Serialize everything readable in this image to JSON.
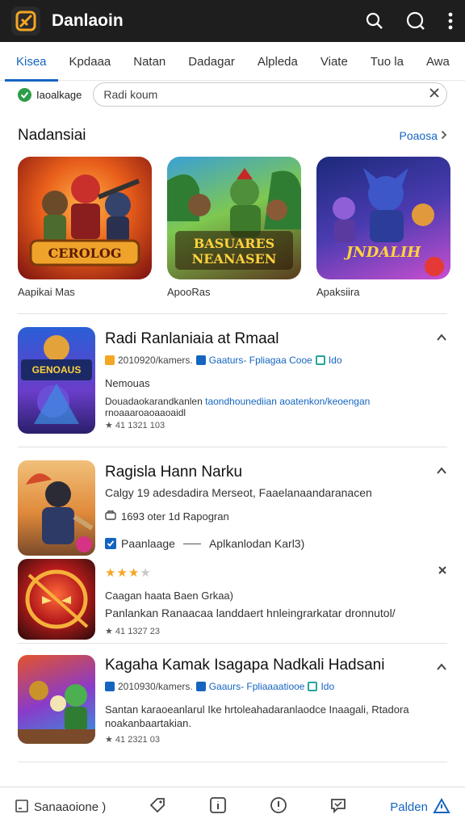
{
  "app": {
    "title": "Danlaoin"
  },
  "tabs": [
    {
      "label": "Kisea"
    },
    {
      "label": "Kpdaaa"
    },
    {
      "label": "Natan"
    },
    {
      "label": "Dadagar"
    },
    {
      "label": "Alpleda"
    },
    {
      "label": "Viate"
    },
    {
      "label": "Tuo la"
    },
    {
      "label": "Awa"
    }
  ],
  "filter": {
    "verified_label": "Iaoalkage",
    "search_value": "Radi koum"
  },
  "section": {
    "title": "Nadansiai",
    "see_more": "Poaosa"
  },
  "featured": [
    {
      "label": "Aapikai Mas",
      "art_text": "CEROLOG"
    },
    {
      "label": "ApooRas",
      "art_text": "BASUARES NEANASEN"
    },
    {
      "label": "Apaksiira",
      "art_text": "JNDALIH"
    }
  ],
  "apps": [
    {
      "title": "Radi Ranlaniaia at Rmaal",
      "meta_left": "2010920/kamers.",
      "meta_link": "Gaaturs- Fpliagaa Cooe",
      "meta_badge": "Ido",
      "subtitle": "Nemouas",
      "desc1_a": "Douadaokarandkanlen",
      "desc1_b": "taondhounediian aoatenkon/keoengan",
      "desc2": "rnoaaaroaoaaoaidl",
      "rating": "★ 41 1321 103",
      "thumb_text": "GENOAUS"
    },
    {
      "title": "Ragisla Hann Narku",
      "line1": "Calgy 19 adesdadira Merseot, Faaelanaandaranacen",
      "line2": "1693 oter 1d Rapogran",
      "check_label": "Paanlaage",
      "check_extra": "Aplkanlodan Karl3)"
    },
    {
      "title": "",
      "stars": 3,
      "subtitle": "Caagan haata Baen Grkaa)",
      "desc": "Panlankan Ranaacaa landdaert hnleingrarkatar dronnutol/",
      "rating": "★ 41 1327 23"
    },
    {
      "title": "Kagaha Kamak Isagapa Nadkali Hadsani",
      "meta_left": "2010930/kamers.",
      "meta_link": "Gaaurs- Fpliaaaatiooe",
      "meta_badge": "Ido",
      "desc1": "Santan karaoeanlarul Ike hrtoleahadaranlaodce Inaagali, Rtadora",
      "desc2": "noakanbaartakian.",
      "rating": "★ 41 2321 03"
    }
  ],
  "bottom": {
    "left_label": "Sanaaoione )",
    "right_label": "Palden"
  },
  "colors": {
    "accent": "#1565c0",
    "topbar": "#1e1e1e",
    "verified": "#2e9d4a",
    "star": "#f5a623"
  }
}
